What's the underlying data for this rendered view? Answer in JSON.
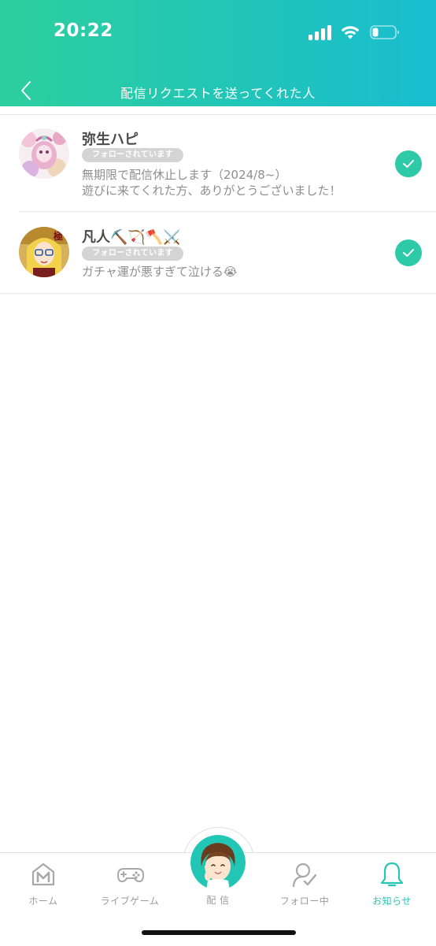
{
  "status_bar": {
    "time": "20:22",
    "icons": [
      "signal-icon",
      "wifi-icon",
      "battery-icon"
    ]
  },
  "nav": {
    "title": "配信リクエストを送ってくれた人",
    "back_icon": "chevron-left-icon"
  },
  "theme": {
    "header_gradient": [
      "#2dcf9e",
      "#18bdd0"
    ],
    "accent": "#2ec9a7",
    "badge_bg": "#d4d4d4",
    "tab_active": "#27c5b5"
  },
  "users": [
    {
      "name": "弥生ハピ",
      "badge": "フォローされています",
      "bio_lines": [
        "無期限で配信休止します（2024/8~）",
        "遊びに来てくれた方、ありがとうございました！"
      ],
      "checked": true
    },
    {
      "name": "凡人⛏️🏹🪓⚔️",
      "badge": "フォローされています",
      "bio_lines": [
        "ガチャ運が悪すぎて泣ける😭"
      ],
      "checked": true
    }
  ],
  "tabbar": {
    "tabs": [
      {
        "label": "ホーム",
        "icon": "home-icon",
        "active": false
      },
      {
        "label": "ライブゲーム",
        "icon": "gamepad-icon",
        "active": false
      },
      {
        "label": "配 信",
        "icon": "streamer-avatar",
        "active": false
      },
      {
        "label": "フォロー中",
        "icon": "following-icon",
        "active": false
      },
      {
        "label": "お知らせ",
        "icon": "bell-icon",
        "active": true
      }
    ]
  }
}
